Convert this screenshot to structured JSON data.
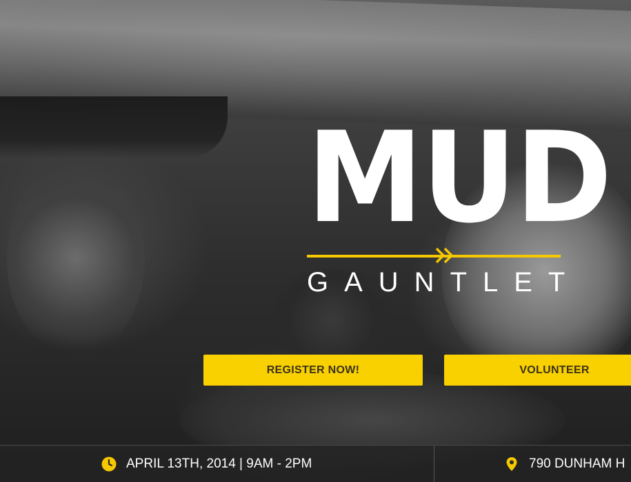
{
  "hero": {
    "logo": {
      "title": "MUD",
      "subtitle": "GAUNTLET",
      "accent_color": "#f5c800"
    },
    "buttons": {
      "register_label": "REGISTER NOW!",
      "volunteer_label": "VOLUNTEER",
      "button_color": "#f9d000"
    }
  },
  "info_bar": {
    "date_icon": "clock-icon",
    "date_text": "APRIL 13TH, 2014 | 9AM - 2PM",
    "location_icon": "map-pin-icon",
    "location_text": "790 DUNHAM H"
  }
}
